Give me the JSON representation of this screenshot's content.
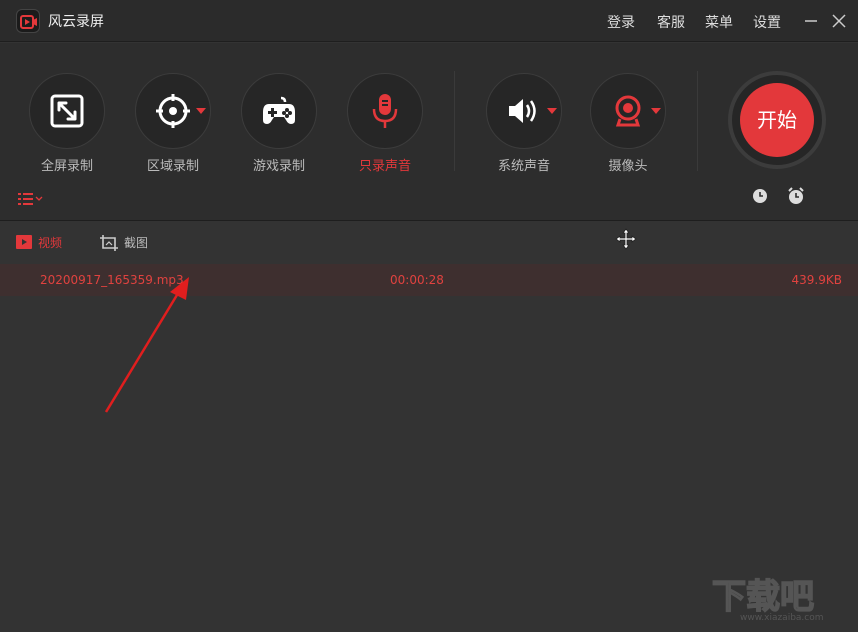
{
  "app": {
    "title": "风云录屏"
  },
  "menu": {
    "login": "登录",
    "service": "客服",
    "menu": "菜单",
    "settings": "设置"
  },
  "tools": [
    {
      "label": "全屏录制"
    },
    {
      "label": "区域录制"
    },
    {
      "label": "游戏录制"
    },
    {
      "label": "只录声音"
    },
    {
      "label": "系统声音"
    },
    {
      "label": "摄像头"
    }
  ],
  "start": {
    "label": "开始"
  },
  "tabs": {
    "video": "视频",
    "screenshot": "截图"
  },
  "files": [
    {
      "name": "20200917_165359.mp3",
      "duration": "00:00:28",
      "size": "439.9KB"
    }
  ],
  "watermark": {
    "text": "下载吧",
    "sub": "www.xiazaiba.com"
  },
  "colors": {
    "accent": "#e3383b",
    "background": "#333333"
  }
}
